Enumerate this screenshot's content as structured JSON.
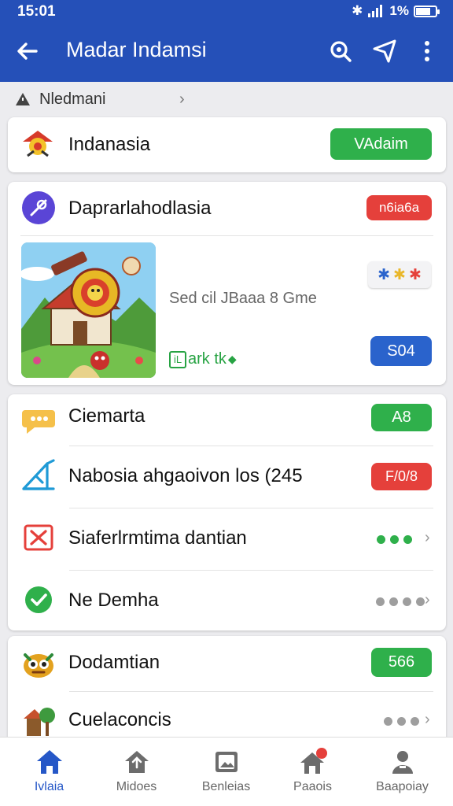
{
  "status": {
    "time": "15:01",
    "battery": "1%"
  },
  "appbar": {
    "title": "Madar Indamsi",
    "back_icon": "arrow-left-icon",
    "actions": [
      "search-icon",
      "send-icon",
      "more-vert-icon"
    ]
  },
  "breadcrumb": {
    "label": "Nledmani",
    "chevron": "›"
  },
  "card1": {
    "label": "Indanasia",
    "button": "VAdaim"
  },
  "card2": {
    "header_label": "Daprarlahodlasia",
    "header_badge": "n6ia6a",
    "game_title": "Sed cil JBaaa 8 Gme",
    "mark_text": "ark tk",
    "mark_box": "iL",
    "mark_symbol": "◆",
    "chips": [
      "✱",
      "✱",
      "✱"
    ],
    "action_button": "S04"
  },
  "card3": {
    "rows": [
      {
        "label": "Ciemarta",
        "badge": "A8"
      },
      {
        "label": "Nabosia ahgaoivon los (245",
        "badge": "F/0/8"
      },
      {
        "label": "Siaferlrmtima dantian",
        "chev": "›"
      },
      {
        "label": "Ne Demha",
        "chev": "›"
      }
    ]
  },
  "card4": {
    "rows": [
      {
        "label": "Dodamtian",
        "badge": "566"
      },
      {
        "label": "Cuelaconcis",
        "chev": "›"
      }
    ]
  },
  "bottomnav": [
    {
      "label": "Ivlaia",
      "icon": "home-icon"
    },
    {
      "label": "Midoes",
      "icon": "upload-home-icon"
    },
    {
      "label": "Benleias",
      "icon": "gallery-icon"
    },
    {
      "label": "Paaois",
      "icon": "notifications-home-icon"
    },
    {
      "label": "Baapoiay",
      "icon": "profile-icon"
    }
  ],
  "colors": {
    "primary": "#2550b8",
    "green": "#2fb04b",
    "red": "#e5403b",
    "blue": "#2a63cc"
  }
}
